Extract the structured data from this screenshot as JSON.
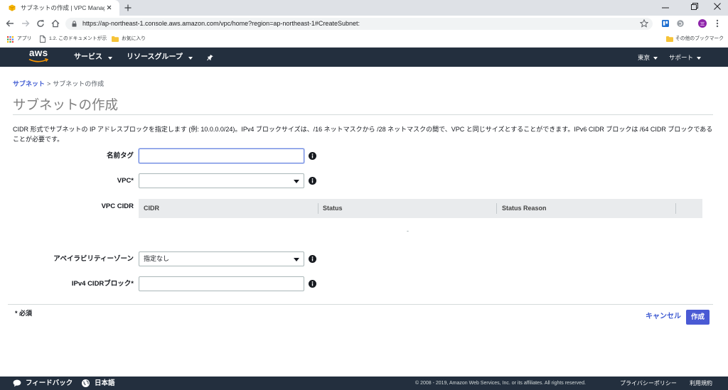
{
  "browser": {
    "tab": {
      "title": "サブネットの作成 | VPC Manageme",
      "favicon": "aws-favicon-icon"
    },
    "omnibox": {
      "url": "https://ap-northeast-1.console.aws.amazon.com/vpc/home?region=ap-northeast-1#CreateSubnet:"
    },
    "bookmarks": [
      {
        "label": "アプリ",
        "icon": "apps-grid-icon"
      },
      {
        "label": "1.2. このドキュメントが示",
        "icon": "document-icon"
      },
      {
        "label": "お気に入り",
        "icon": "folder-icon"
      }
    ],
    "other_bookmarks": {
      "label": "その他のブックマーク",
      "icon": "folder-icon"
    }
  },
  "console_nav": {
    "logo": "aws",
    "services": "サービス",
    "resource_groups": "リソースグループ",
    "region": "東京",
    "support": "サポート"
  },
  "breadcrumb": {
    "parent": "サブネット",
    "separator": ">",
    "current": "サブネットの作成"
  },
  "page_title": "サブネットの作成",
  "description": "CIDR 形式でサブネットの IP アドレスブロックを指定します (例: 10.0.0.0/24)。IPv4 ブロックサイズは、/16 ネットマスクから /28 ネットマスクの間で、VPC と同じサイズとすることができます。IPv6 CIDR ブロックは /64 CIDR ブロックであることが必要です。",
  "form": {
    "name_tag": {
      "label": "名前タグ",
      "value": ""
    },
    "vpc": {
      "label": "VPC*",
      "value": ""
    },
    "vpc_cidr": {
      "label": "VPC CIDR",
      "columns": [
        "CIDR",
        "Status",
        "Status Reason"
      ],
      "empty": "-"
    },
    "availability_zone": {
      "label": "アベイラビリティーゾーン",
      "value": "指定なし"
    },
    "ipv4_cidr": {
      "label": "IPv4 CIDRブロック*",
      "value": ""
    }
  },
  "required_note": "* 必須",
  "actions": {
    "cancel": "キャンセル",
    "create": "作成"
  },
  "footer": {
    "feedback": "フィードバック",
    "language": "日本語",
    "copyright": "© 2008 - 2019, Amazon Web Services, Inc. or its affiliates. All rights reserved.",
    "privacy": "プライバシーポリシー",
    "terms": "利用規約"
  },
  "colors": {
    "nav_bg": "#232f3e",
    "link": "#3f5bd2",
    "primary_button": "#4a5ad4",
    "focus": "#6a86e0",
    "table_header_bg": "#e9ebed",
    "chrome_strip": "#dee1e6",
    "omnibox_bg": "#f1f3f4",
    "aws_orange": "#ff9900"
  }
}
